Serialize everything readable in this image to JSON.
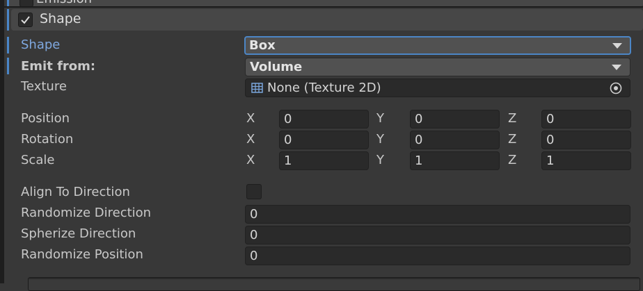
{
  "previous_module": {
    "title": "Emission",
    "enabled": true
  },
  "module": {
    "title": "Shape",
    "enabled": true
  },
  "fields": {
    "shape": {
      "label": "Shape",
      "value": "Box"
    },
    "emit_from": {
      "label": "Emit from:",
      "value": "Volume"
    },
    "texture": {
      "label": "Texture",
      "value": "None (Texture 2D)"
    },
    "position": {
      "label": "Position",
      "x_label": "X",
      "y_label": "Y",
      "z_label": "Z",
      "x": "0",
      "y": "0",
      "z": "0"
    },
    "rotation": {
      "label": "Rotation",
      "x_label": "X",
      "y_label": "Y",
      "z_label": "Z",
      "x": "0",
      "y": "0",
      "z": "0"
    },
    "scale": {
      "label": "Scale",
      "x_label": "X",
      "y_label": "Y",
      "z_label": "Z",
      "x": "1",
      "y": "1",
      "z": "1"
    },
    "align_to_direction": {
      "label": "Align To Direction",
      "checked": false
    },
    "randomize_direction": {
      "label": "Randomize Direction",
      "value": "0"
    },
    "spherize_direction": {
      "label": "Spherize Direction",
      "value": "0"
    },
    "randomize_position": {
      "label": "Randomize Position",
      "value": "0"
    }
  },
  "icons": {
    "checkbox": "checkmark-icon",
    "dropdown": "triangle-down-icon",
    "texture": "texture-grid-icon",
    "picker": "object-picker-icon"
  },
  "colors": {
    "accent": "#4a86c8",
    "label_highlight": "#7fa8e0",
    "background": "#383838"
  }
}
